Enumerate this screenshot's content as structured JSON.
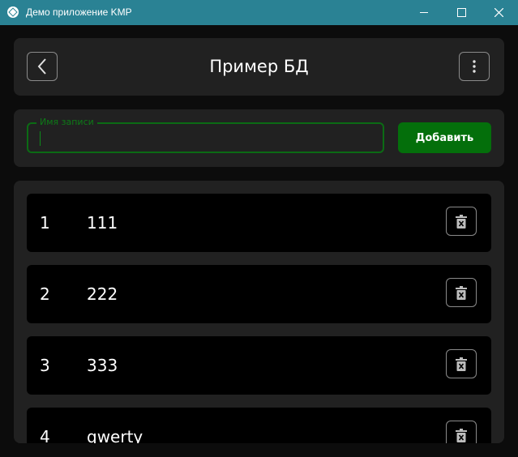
{
  "window": {
    "title": "Демо приложение KMP"
  },
  "header": {
    "title": "Пример БД"
  },
  "form": {
    "label": "Имя записи",
    "value": "",
    "add_label": "Добавить"
  },
  "records": [
    {
      "id": "1",
      "name": "111"
    },
    {
      "id": "2",
      "name": "222"
    },
    {
      "id": "3",
      "name": "333"
    },
    {
      "id": "4",
      "name": "qwerty"
    }
  ],
  "colors": {
    "titlebar": "#2a8294",
    "accent_green": "#046f0b",
    "panel": "#212121",
    "row": "#000000"
  },
  "icons": [
    "app-icon",
    "minimize-icon",
    "maximize-icon",
    "close-icon",
    "back-arrow-icon",
    "more-vert-icon",
    "delete-icon"
  ]
}
